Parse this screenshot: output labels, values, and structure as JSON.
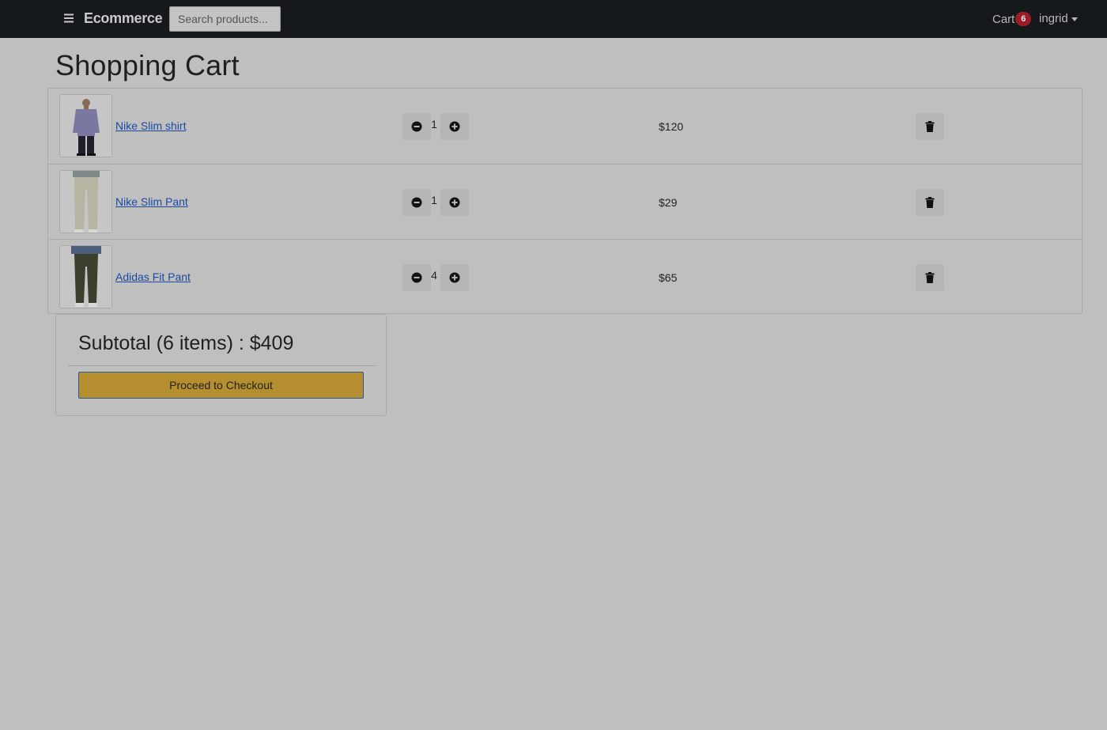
{
  "navbar": {
    "menu_icon": "hamburger-icon",
    "brand": "Ecommerce",
    "search_placeholder": "Search products...",
    "cart_label": "Cart",
    "cart_count": "6",
    "user_name": "ingrid"
  },
  "page": {
    "title": "Shopping Cart"
  },
  "cart": {
    "items": [
      {
        "name": "Nike Slim shirt",
        "quantity": "1",
        "price": "$120",
        "image_icon": "shirt-product-image"
      },
      {
        "name": "Nike Slim Pant",
        "quantity": "1",
        "price": "$29",
        "image_icon": "pant-product-image"
      },
      {
        "name": "Adidas Fit Pant",
        "quantity": "4",
        "price": "$65",
        "image_icon": "pant-product-image"
      }
    ],
    "icons": {
      "decrease": "minus-circle-icon",
      "increase": "plus-circle-icon",
      "delete": "trash-icon"
    }
  },
  "summary": {
    "subtotal": "Subtotal (6 items) : $409",
    "checkout_label": "Proceed to Checkout"
  },
  "colors": {
    "navbar_bg": "#16191c",
    "page_bg": "#bfbfbf",
    "badge": "#9b1c27",
    "checkout_button": "#b48e2f",
    "link": "#1c4aa0"
  }
}
